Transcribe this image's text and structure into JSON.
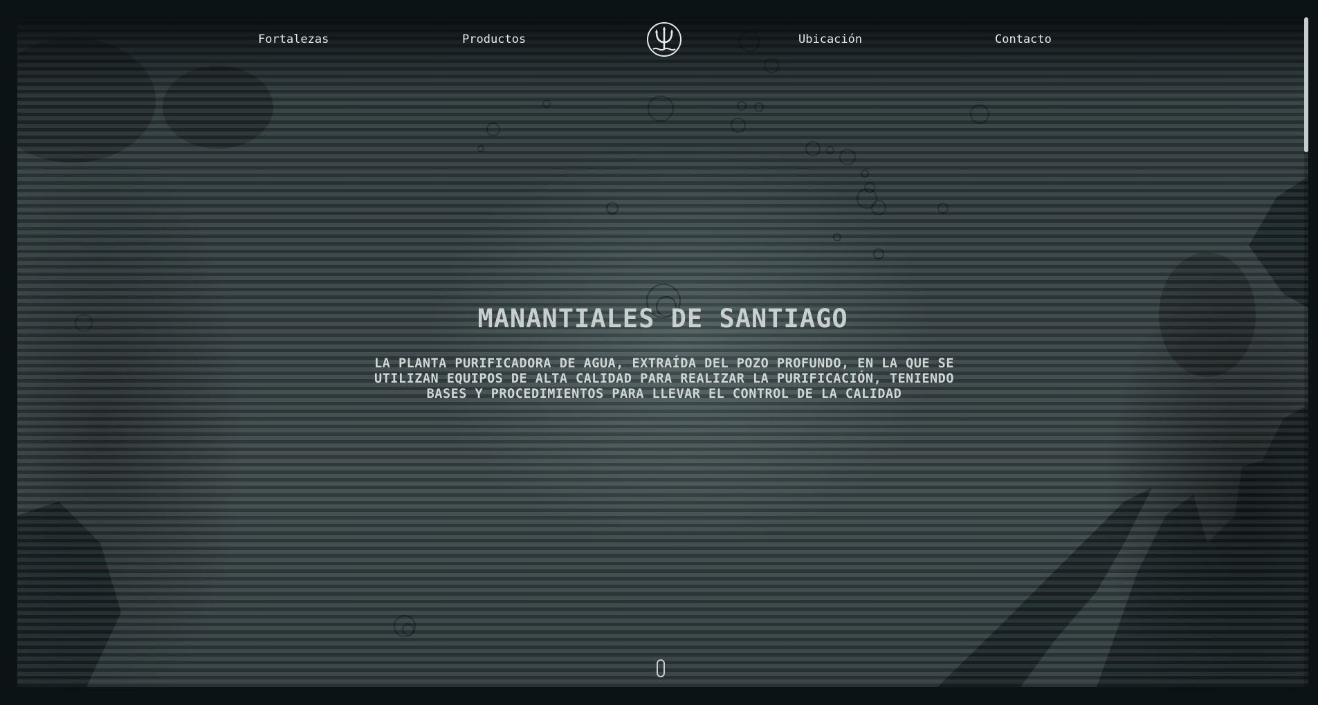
{
  "nav": {
    "links": [
      {
        "label": "Fortalezas"
      },
      {
        "label": "Productos"
      },
      {
        "label": "Ubicación"
      },
      {
        "label": "Contacto"
      }
    ],
    "logo_icon": "trident-icon"
  },
  "hero": {
    "title": "MANANTIALES DE SANTIAGO",
    "subtitle": "LA PLANTA PURIFICADORA DE AGUA, EXTRAÍDA DEL POZO PROFUNDO, EN LA QUE SE UTILIZAN EQUIPOS DE ALTA CALIDAD PARA REALIZAR LA PURIFICACIÓN, TENIENDO BASES Y PROCEDIMIENTOS PARA LLEVAR EL CONTROL DE LA CALIDAD",
    "scroll_icon": "mouse-scroll-icon"
  },
  "colors": {
    "background": "#0c1315",
    "hero_base": "#344042",
    "text": "#e6eaea",
    "title": "#c9cfcf"
  }
}
